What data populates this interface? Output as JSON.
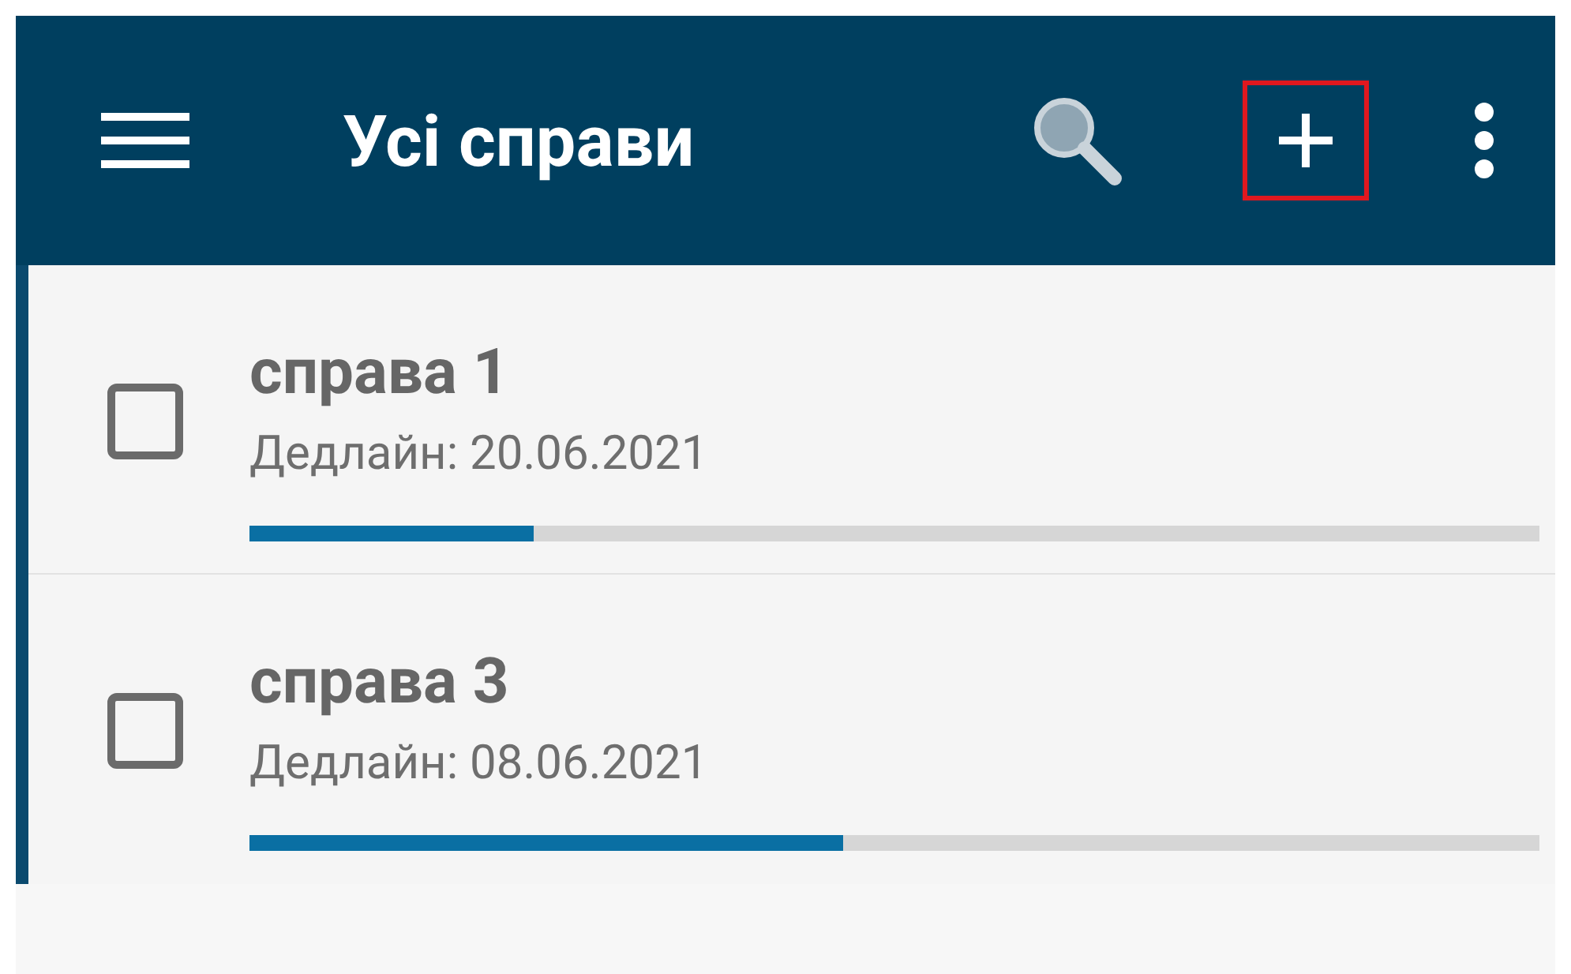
{
  "app_bar": {
    "title": "Усі справи",
    "actions": [
      {
        "kind": "search",
        "highlighted": false
      },
      {
        "kind": "add",
        "highlighted": true
      },
      {
        "kind": "more",
        "highlighted": false
      }
    ]
  },
  "tasks": [
    {
      "title": "справа 1",
      "deadline": "Дедлайн: 20.06.2021",
      "checked": false,
      "level": 0.22
    },
    {
      "title": "справа 3",
      "deadline": "Дедлайн: 08.06.2021",
      "checked": false,
      "level": 0.46
    }
  ]
}
